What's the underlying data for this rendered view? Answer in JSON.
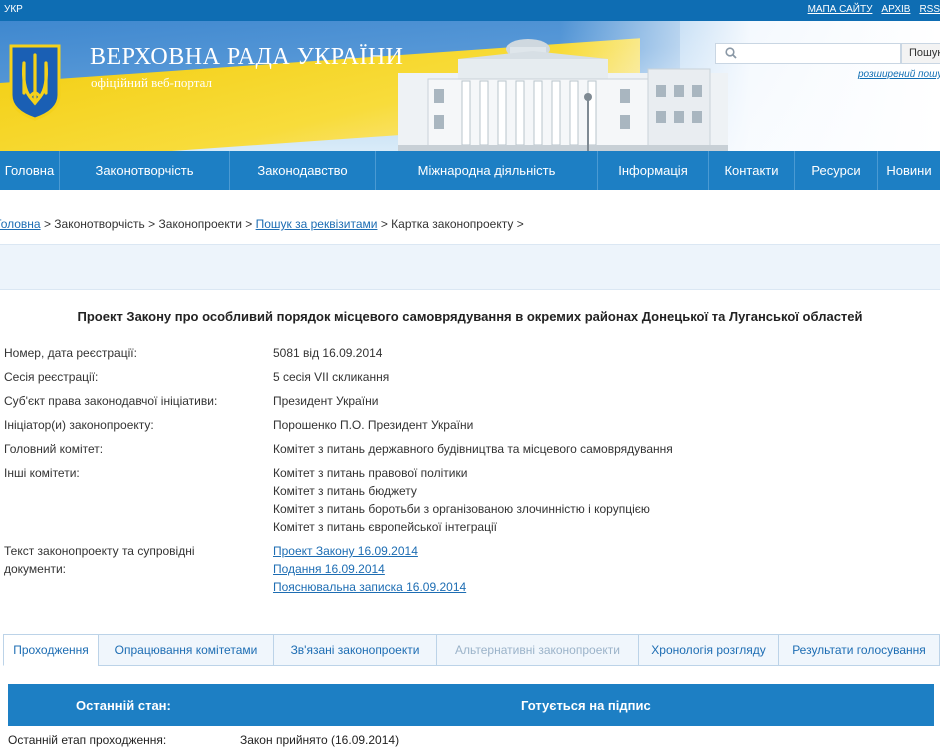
{
  "topbar": {
    "lang": "УКР",
    "links": [
      "МАПА САЙТУ",
      "АРХІВ",
      "RSS"
    ]
  },
  "header": {
    "title": "ВЕРХОВНА РАДА УКРАЇНИ",
    "subtitle": "офіційний веб-портал",
    "search_button": "Пошук",
    "advanced_search": "розширений пошук",
    "search_placeholder": ""
  },
  "nav": {
    "items": [
      "Головна",
      "Законотворчість",
      "Законодавство",
      "Міжнародна діяльність",
      "Інформація",
      "Контакти",
      "Ресурси",
      "Новини"
    ]
  },
  "breadcrumb": {
    "home": "Головна",
    "lawmaking": "Законотворчість",
    "bills": "Законопроекти",
    "search": "Пошук за реквізитами",
    "card": "Картка законопроекту"
  },
  "bill": {
    "title": "Проект Закону про особливий порядок місцевого самоврядування в окремих районах Донецької та Луганської областей",
    "fields": [
      {
        "label": "Номер, дата реєстрації:",
        "value": "5081 від 16.09.2014"
      },
      {
        "label": "Сесія реєстрації:",
        "value": "5 сесія VII скликання"
      },
      {
        "label": "Суб'єкт права законодавчої ініціативи:",
        "value": "Президент України"
      },
      {
        "label": "Ініціатор(и) законопроекту:",
        "value": "Порошенко П.О. Президент України"
      },
      {
        "label": "Головний комітет:",
        "value": "Комітет з питань державного будівництва та місцевого самоврядування"
      }
    ],
    "other_committees_label": "Інші комітети:",
    "other_committees": [
      "Комітет з питань правової політики",
      "Комітет з питань бюджету",
      "Комітет з питань боротьби з організованою злочинністю і корупцією",
      "Комітет з питань європейської інтеграції"
    ],
    "documents_label_1": "Текст законопроекту та супровідні",
    "documents_label_2": "документи:",
    "documents": [
      "Проект Закону 16.09.2014",
      "Подання 16.09.2014",
      "Пояснювальна записка 16.09.2014"
    ]
  },
  "tabs": [
    "Проходження",
    "Опрацювання комітетами",
    "Зв'язані законопроекти",
    "Альтернативні законопроекти",
    "Хронологія розгляду",
    "Результати голосування"
  ],
  "status": {
    "label": "Останній стан:",
    "value": "Готується на підпис",
    "stage_label": "Останній етап проходження:",
    "stage_value": "Закон прийнято (16.09.2014)"
  },
  "colors": {
    "nav_blue": "#1d7fc4",
    "link_blue": "#1d6db3",
    "flag_yellow": "#f4d11a",
    "flag_blue": "#3f88cf"
  }
}
